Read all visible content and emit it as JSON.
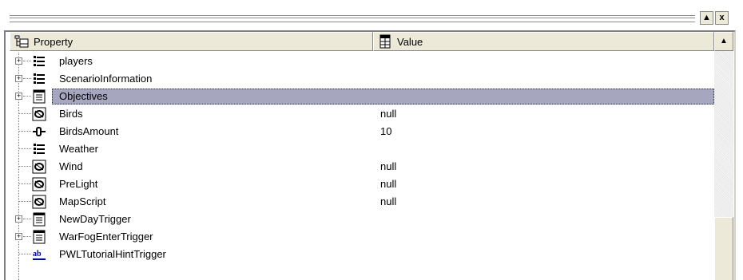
{
  "window": {
    "pin_button_label": "▲",
    "close_button_label": "x"
  },
  "grid": {
    "headers": {
      "property": "Property",
      "value": "Value"
    },
    "rows": [
      {
        "name": "players",
        "value": "",
        "icon": "folder-icon",
        "expandable": true,
        "selected": false
      },
      {
        "name": "ScenarioInformation",
        "value": "",
        "icon": "folder-icon",
        "expandable": true,
        "selected": false
      },
      {
        "name": "Objectives",
        "value": "",
        "icon": "list-icon",
        "expandable": true,
        "selected": true
      },
      {
        "name": "Birds",
        "value": "null",
        "icon": "object-icon",
        "expandable": false,
        "selected": false
      },
      {
        "name": "BirdsAmount",
        "value": "10",
        "icon": "number-icon",
        "expandable": false,
        "selected": false
      },
      {
        "name": "Weather",
        "value": "",
        "icon": "folder-icon",
        "expandable": false,
        "selected": false
      },
      {
        "name": "Wind",
        "value": "null",
        "icon": "object-icon",
        "expandable": false,
        "selected": false
      },
      {
        "name": "PreLight",
        "value": "null",
        "icon": "object-icon",
        "expandable": false,
        "selected": false
      },
      {
        "name": "MapScript",
        "value": "null",
        "icon": "object-icon",
        "expandable": false,
        "selected": false
      },
      {
        "name": "NewDayTrigger",
        "value": "",
        "icon": "list-icon",
        "expandable": true,
        "selected": false
      },
      {
        "name": "WarFogEnterTrigger",
        "value": "",
        "icon": "list-icon",
        "expandable": true,
        "selected": false
      },
      {
        "name": "PWLTutorialHintTrigger",
        "value": "",
        "icon": "string-icon",
        "expandable": false,
        "selected": false
      }
    ]
  },
  "scrollbar": {
    "up_arrow": "▲"
  }
}
